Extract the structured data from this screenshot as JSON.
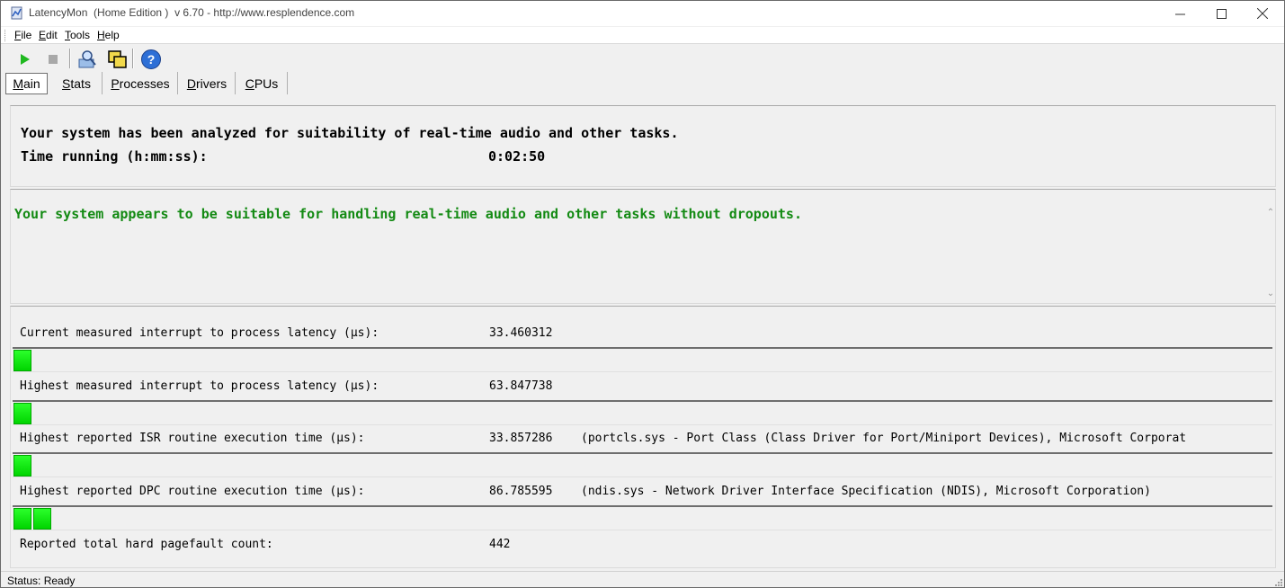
{
  "window": {
    "title": "LatencyMon  (Home Edition )  v 6.70 - http://www.resplendence.com"
  },
  "menu": [
    {
      "label": "File",
      "accel": "F",
      "rest": "ile"
    },
    {
      "label": "Edit",
      "accel": "E",
      "rest": "dit"
    },
    {
      "label": "Tools",
      "accel": "T",
      "rest": "ools"
    },
    {
      "label": "Help",
      "accel": "H",
      "rest": "elp"
    }
  ],
  "toolbar": {
    "buttons": [
      "play-icon",
      "stop-icon",
      "analyze-icon",
      "windows-icon",
      "help-icon"
    ]
  },
  "tabs": [
    {
      "label": "Main",
      "accel": "M",
      "rest": "ain",
      "active": true
    },
    {
      "label": "Stats",
      "accel": "S",
      "rest": "tats"
    },
    {
      "label": "Processes",
      "accel": "P",
      "rest": "rocesses"
    },
    {
      "label": "Drivers",
      "accel": "D",
      "rest": "rivers"
    },
    {
      "label": "CPUs",
      "accel": "C",
      "rest": "PUs"
    }
  ],
  "summary": {
    "line1": "Your system has been analyzed for suitability of real-time audio and other tasks.",
    "time_label": "Time running (h:mm:ss):",
    "time_value": "0:02:50"
  },
  "verdict": {
    "message": "Your system appears to be suitable for handling real-time audio and other tasks without dropouts.",
    "color": "#138a13"
  },
  "metrics": [
    {
      "label": "Current measured interrupt to process latency (µs):",
      "value": "33.460312",
      "detail": "",
      "bar_segments": 1
    },
    {
      "label": "Highest measured interrupt to process latency (µs):",
      "value": "63.847738",
      "detail": "",
      "bar_segments": 1
    },
    {
      "label": "Highest reported ISR routine execution time (µs):",
      "value": "33.857286",
      "detail": "(portcls.sys - Port Class (Class Driver for Port/Miniport Devices), Microsoft Corporat",
      "bar_segments": 1
    },
    {
      "label": "Highest reported DPC routine execution time (µs):",
      "value": "86.785595",
      "detail": "(ndis.sys - Network Driver Interface Specification (NDIS), Microsoft Corporation)",
      "bar_segments": 2
    }
  ],
  "pagefault": {
    "label": "Reported total hard pagefault count:",
    "value": "442"
  },
  "status": {
    "text": "Status: Ready"
  }
}
